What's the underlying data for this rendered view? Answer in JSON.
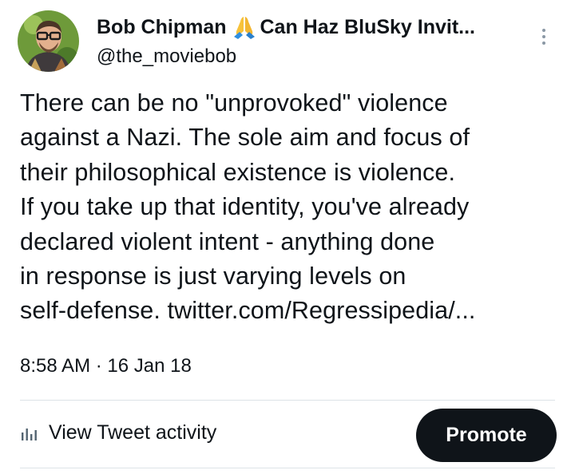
{
  "author": {
    "display_name": "Bob Chipman",
    "name_suffix": "Can Haz BluSky Invit...",
    "handle": "@the_moviebob",
    "avatar_bg": "#6e9a3a"
  },
  "tweet": {
    "lines": [
      "There can be no \"unprovoked\" violence",
      "against a Nazi. The sole aim and focus of",
      "their philosophical existence is violence.",
      "If you take up that identity, you've already",
      "declared violent intent - anything done",
      "in response is just varying levels on",
      "self-defense. twitter.com/Regressipedia/..."
    ],
    "time": "8:58 AM",
    "separator": "·",
    "date": "16 Jan 18"
  },
  "actions": {
    "activity_label": "View Tweet activity",
    "promote_label": "Promote"
  },
  "icons": {
    "emoji": "folded-hands-icon",
    "more": "more-options-icon",
    "activity": "bar-chart-icon"
  }
}
